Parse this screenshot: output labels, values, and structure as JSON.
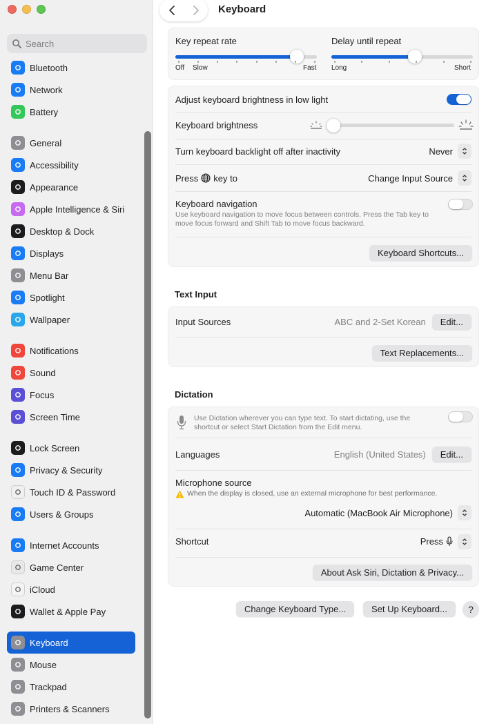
{
  "window": {
    "title": "Keyboard"
  },
  "colors": {
    "accent": "#1462d5",
    "close": "#ed6a5e",
    "minimize": "#f5bf4f",
    "zoom": "#61c554"
  },
  "search": {
    "placeholder": "Search"
  },
  "sidebar": {
    "groups": [
      [
        {
          "label": "Bluetooth",
          "icon": "bluetooth-icon",
          "color": "#1a7cf5"
        },
        {
          "label": "Network",
          "icon": "globe-icon",
          "color": "#1a7cf5"
        },
        {
          "label": "Battery",
          "icon": "battery-icon",
          "color": "#34c759"
        }
      ],
      [
        {
          "label": "General",
          "icon": "gear-icon",
          "color": "#8e8e93"
        },
        {
          "label": "Accessibility",
          "icon": "accessibility-icon",
          "color": "#1a7cf5"
        },
        {
          "label": "Appearance",
          "icon": "appearance-icon",
          "color": "#1c1c1e"
        },
        {
          "label": "Apple Intelligence & Siri",
          "icon": "siri-icon",
          "color": "#c66bf0"
        },
        {
          "label": "Desktop & Dock",
          "icon": "dock-icon",
          "color": "#1c1c1e"
        },
        {
          "label": "Displays",
          "icon": "sun-icon",
          "color": "#1a7cf5"
        },
        {
          "label": "Menu Bar",
          "icon": "menubar-icon",
          "color": "#8e8e93"
        },
        {
          "label": "Spotlight",
          "icon": "magnifier-icon",
          "color": "#1a7cf5"
        },
        {
          "label": "Wallpaper",
          "icon": "flower-icon",
          "color": "#29a7ea"
        }
      ],
      [
        {
          "label": "Notifications",
          "icon": "bell-icon",
          "color": "#f0463c"
        },
        {
          "label": "Sound",
          "icon": "speaker-icon",
          "color": "#f0463c"
        },
        {
          "label": "Focus",
          "icon": "moon-icon",
          "color": "#5b4fd6"
        },
        {
          "label": "Screen Time",
          "icon": "hourglass-icon",
          "color": "#5b4fd6"
        }
      ],
      [
        {
          "label": "Lock Screen",
          "icon": "lock-icon",
          "color": "#1c1c1e"
        },
        {
          "label": "Privacy & Security",
          "icon": "hand-icon",
          "color": "#1a7cf5"
        },
        {
          "label": "Touch ID & Password",
          "icon": "fingerprint-icon",
          "color": "#f0f0f0"
        },
        {
          "label": "Users & Groups",
          "icon": "users-icon",
          "color": "#1a7cf5"
        }
      ],
      [
        {
          "label": "Internet Accounts",
          "icon": "at-icon",
          "color": "#1a7cf5"
        },
        {
          "label": "Game Center",
          "icon": "gamecenter-icon",
          "color": "#e8e8e8"
        },
        {
          "label": "iCloud",
          "icon": "cloud-icon",
          "color": "#f4f4f4"
        },
        {
          "label": "Wallet & Apple Pay",
          "icon": "wallet-icon",
          "color": "#1c1c1e"
        }
      ],
      [
        {
          "label": "Keyboard",
          "icon": "keyboard-icon",
          "color": "#8e8e93",
          "selected": true
        },
        {
          "label": "Mouse",
          "icon": "mouse-icon",
          "color": "#8e8e93"
        },
        {
          "label": "Trackpad",
          "icon": "trackpad-icon",
          "color": "#8e8e93"
        },
        {
          "label": "Printers & Scanners",
          "icon": "printer-icon",
          "color": "#8e8e93"
        }
      ]
    ]
  },
  "repeat": {
    "key_repeat_label": "Key repeat rate",
    "key_repeat_value": 0.86,
    "key_repeat_ticks": [
      "Off",
      "Slow",
      "Fast"
    ],
    "delay_label": "Delay until repeat",
    "delay_value": 0.59,
    "delay_ticks": [
      "Long",
      "Short"
    ]
  },
  "backlight": {
    "adjust_label": "Adjust keyboard brightness in low light",
    "adjust_on": true,
    "brightness_label": "Keyboard brightness",
    "brightness_value": 0.0,
    "timeout_label": "Turn keyboard backlight off after inactivity",
    "timeout_value": "Never",
    "press_prefix": "Press",
    "press_suffix": "key to",
    "press_value": "Change Input Source",
    "nav_label": "Keyboard navigation",
    "nav_desc": "Use keyboard navigation to move focus between controls. Press the Tab key to move focus forward and Shift Tab to move focus backward.",
    "nav_on": false,
    "shortcuts_button": "Keyboard Shortcuts..."
  },
  "text_input": {
    "title": "Text Input",
    "sources_label": "Input Sources",
    "sources_value": "ABC and 2-Set Korean",
    "edit_button": "Edit...",
    "replacements_button": "Text Replacements..."
  },
  "dictation": {
    "title": "Dictation",
    "desc": "Use Dictation wherever you can type text. To start dictating, use the shortcut or select Start Dictation from the Edit menu.",
    "on": false,
    "languages_label": "Languages",
    "languages_value": "English (United States)",
    "edit_button": "Edit...",
    "mic_label": "Microphone source",
    "mic_warning": "When the display is closed, use an external microphone for best performance.",
    "mic_value": "Automatic (MacBook Air Microphone)",
    "shortcut_label": "Shortcut",
    "shortcut_value": "Press",
    "about_button": "About Ask Siri, Dictation & Privacy..."
  },
  "footer": {
    "change_type_button": "Change Keyboard Type...",
    "setup_button": "Set Up Keyboard...",
    "help_button": "?"
  }
}
